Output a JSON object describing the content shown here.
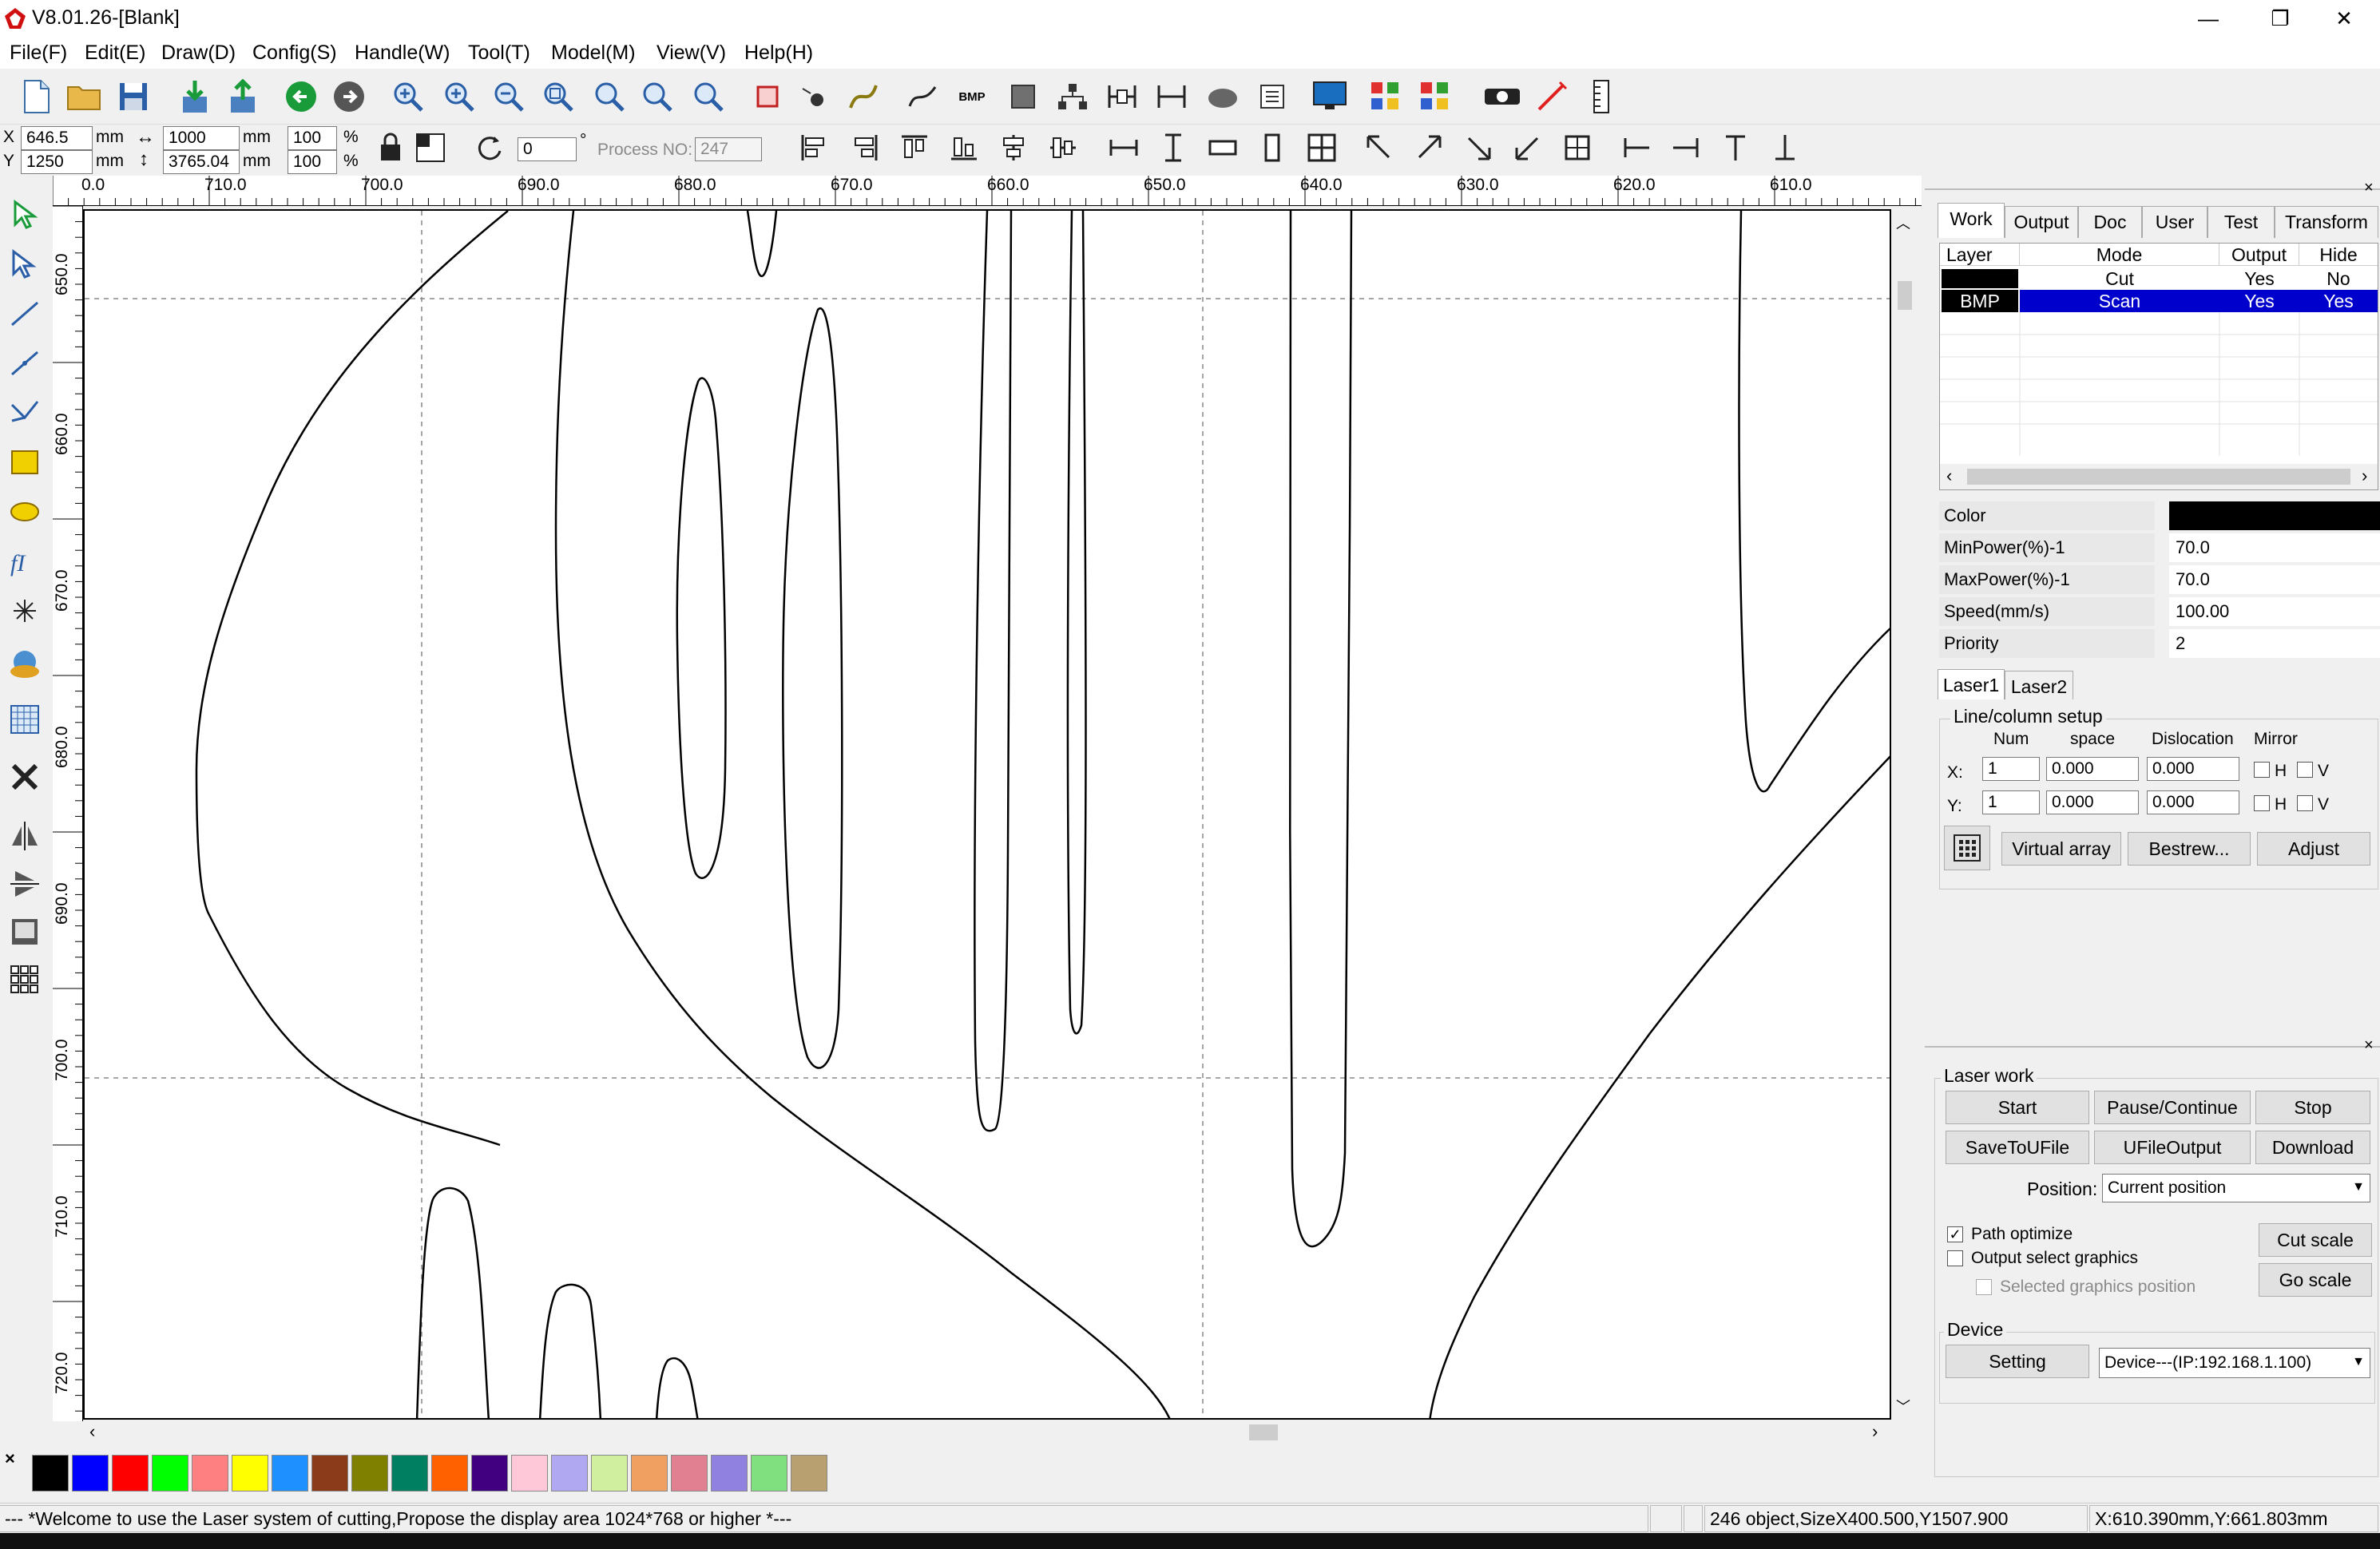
{
  "window": {
    "title": "V8.01.26-[Blank]",
    "minimize": "—",
    "maximize": "❐",
    "close": "✕"
  },
  "menu": [
    "File(F)",
    "Edit(E)",
    "Draw(D)",
    "Config(S)",
    "Handle(W)",
    "Tool(T)",
    "Model(M)",
    "View(V)",
    "Help(H)"
  ],
  "position_bar": {
    "x_label": "X",
    "x_value": "646.5",
    "y_label": "Y",
    "y_value": "1250",
    "unit": "mm",
    "width_value": "1000",
    "height_value": "3765.04",
    "width_pct": "100",
    "height_pct": "100",
    "pct": "%",
    "rotate_value": "0",
    "degree": "°",
    "process_label": "Process NO:",
    "process_value": "247"
  },
  "ruler": {
    "h_labels": [
      "0.0",
      "710.0",
      "700.0",
      "690.0",
      "680.0",
      "670.0",
      "660.0",
      "650.0",
      "640.0",
      "630.0",
      "620.0",
      "610.0"
    ],
    "v_labels": [
      "650.0",
      "660.0",
      "670.0",
      "680.0",
      "690.0",
      "700.0",
      "710.0",
      "720.0"
    ]
  },
  "palette": {
    "close": "×",
    "colors": [
      "#000000",
      "#0000ff",
      "#ff0000",
      "#00ff00",
      "#ff8080",
      "#ffff00",
      "#1e90ff",
      "#8b3a1a",
      "#808000",
      "#008060",
      "#ff6000",
      "#400080",
      "#ffc8d8",
      "#b0a8f0",
      "#d0f0a0",
      "#f0a060",
      "#e08090",
      "#9080e0",
      "#80e080",
      "#b8a070"
    ]
  },
  "status": {
    "message": "--- *Welcome to use the Laser system of cutting,Propose the display area 1024*768 or higher *---",
    "objects": "246 object,SizeX400.500,Y1507.900",
    "coords": "X:610.390mm,Y:661.803mm"
  },
  "panel": {
    "tabs": [
      "Work",
      "Output",
      "Doc",
      "User",
      "Test",
      "Transform"
    ],
    "layer_table": {
      "headers": [
        "Layer",
        "Mode",
        "Output",
        "Hide"
      ],
      "rows": [
        {
          "layer": "",
          "mode": "Cut",
          "output": "Yes",
          "hide": "No"
        },
        {
          "layer": "BMP",
          "mode": "Scan",
          "output": "Yes",
          "hide": "Yes"
        }
      ]
    },
    "props": [
      {
        "label": "Color",
        "value": ""
      },
      {
        "label": "MinPower(%)-1",
        "value": "70.0"
      },
      {
        "label": "MaxPower(%)-1",
        "value": "70.0"
      },
      {
        "label": "Speed(mm/s)",
        "value": "100.00"
      },
      {
        "label": "Priority",
        "value": "2"
      }
    ],
    "laser_tabs": [
      "Laser1",
      "Laser2"
    ],
    "array": {
      "title": "Line/column setup",
      "headers": [
        "Num",
        "space",
        "Dislocation",
        "Mirror"
      ],
      "x_label": "X:",
      "y_label": "Y:",
      "x_num": "1",
      "x_space": "0.000",
      "x_disloc": "0.000",
      "y_num": "1",
      "y_space": "0.000",
      "y_disloc": "0.000",
      "mirror_h": "H",
      "mirror_v": "V",
      "virtual_array": "Virtual array",
      "bestrew": "Bestrew...",
      "adjust": "Adjust"
    },
    "laser_work": {
      "title": "Laser work",
      "start": "Start",
      "pause": "Pause/Continue",
      "stop": "Stop",
      "save_ufile": "SaveToUFile",
      "ufile_output": "UFileOutput",
      "download": "Download",
      "position_label": "Position:",
      "position_value": "Current position",
      "path_optimize": "Path optimize",
      "output_select": "Output select graphics",
      "selected_pos": "Selected graphics position",
      "cut_scale": "Cut scale",
      "go_scale": "Go scale"
    },
    "device": {
      "title": "Device",
      "setting": "Setting",
      "device_value": "Device---(IP:192.168.1.100)"
    }
  },
  "colors": {
    "selected_row": "#0000cc",
    "accent_green": "#1a9b3a"
  }
}
